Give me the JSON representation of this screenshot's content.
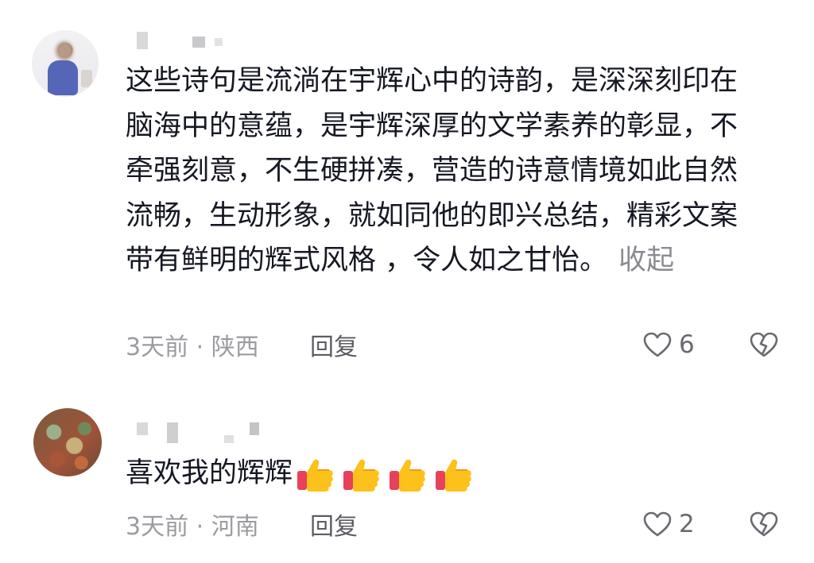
{
  "comments": [
    {
      "text": "这些诗句是流淌在宇辉心中的诗韵，是深深刻印在脑海中的意蕴，是宇辉深厚的文学素养的彰显，不牵强刻意，不生硬拼凑，营造的诗意情境如此自然流畅，生动形象，就如同他的即兴总结，精彩文案带有鲜明的辉式风格 ，令人如之甘怡。",
      "collapse_label": "收起",
      "time_location": "3天前 · 陕西",
      "reply_label": "回复",
      "like_count": "6"
    },
    {
      "text": "喜欢我的辉辉",
      "emoji": [
        "thumbs-up",
        "thumbs-up",
        "thumbs-up",
        "thumbs-up"
      ],
      "time_location": "3天前 · 河南",
      "reply_label": "回复",
      "like_count": "2"
    }
  ],
  "colors": {
    "text": "#161823",
    "meta": "#9b9ca1",
    "reply": "#5b5c63",
    "collapse": "#8a8b91"
  }
}
